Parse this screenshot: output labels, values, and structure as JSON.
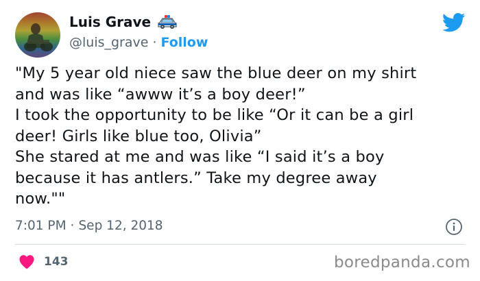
{
  "author": {
    "name": "Luis Grave",
    "handle": "@luis_grave",
    "separator": "·",
    "follow_label": "Follow",
    "emoji": "police-car-emoji"
  },
  "tweet": {
    "lines": [
      "\"My 5 year old niece saw the blue deer on my shirt",
      "and was like “awww it’s a boy deer!”",
      "I took the opportunity to be like “Or it can be a girl",
      "deer! Girls like blue too, Olivia”",
      "She stared at me and was like “I said it’s a boy",
      "because it has antlers.” Take my degree away",
      "now.\"\""
    ],
    "time": "7:01 PM",
    "separator": "·",
    "date": "Sep 12, 2018"
  },
  "engagement": {
    "likes": "143"
  },
  "watermark": "boredpanda.com",
  "colors": {
    "accent": "#1d9bf0",
    "heart": "#f91880",
    "text": "#0f1419",
    "muted": "#536471"
  }
}
